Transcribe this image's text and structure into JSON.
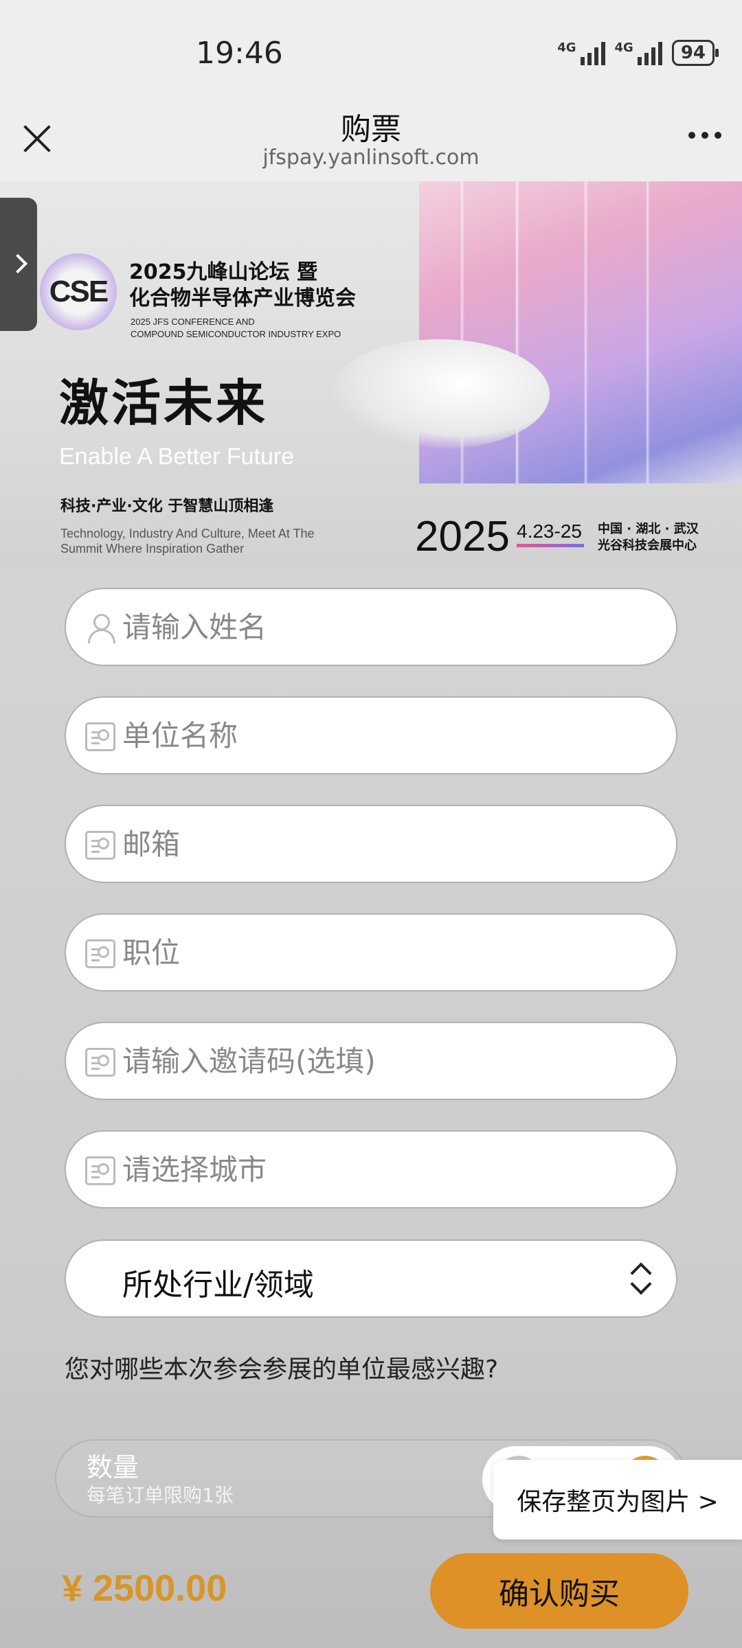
{
  "status_bar": {
    "time": "19:46",
    "network": [
      "4G",
      "4G"
    ],
    "battery": "94"
  },
  "nav": {
    "title": "购票",
    "url": "jfspay.yanlinsoft.com"
  },
  "banner": {
    "logo_text": "CSE",
    "conference_title_line1": "2025九峰山论坛 暨",
    "conference_title_line2": "化合物半导体产业博览会",
    "conference_en_line1": "2025 JFS CONFERENCE AND",
    "conference_en_line2": "COMPOUND SEMICONDUCTOR INDUSTRY EXPO",
    "slogan": "激活未来",
    "slogan_en": "Enable A Better Future",
    "tagline": "科技·产业·文化 于智慧山顶相逢",
    "tagline_en": "Technology, Industry And Culture, Meet At The Summit Where Inspiration Gather",
    "year": "2025",
    "dates": "4.23-25",
    "venue_line1": "中国 · 湖北 · 武汉",
    "venue_line2": "光谷科技会展中心"
  },
  "form": {
    "name_placeholder": "请输入姓名",
    "company_placeholder": "单位名称",
    "email_placeholder": "邮箱",
    "position_placeholder": "职位",
    "invite_placeholder": "请输入邀请码(选填)",
    "city_placeholder": "请选择城市",
    "industry_select": "所处行业/领域",
    "question": "您对哪些本次参会参展的单位最感兴趣?"
  },
  "quantity": {
    "label": "数量",
    "limit_note": "每笔订单限购1张"
  },
  "popup": {
    "save_page": "保存整页为图片 >"
  },
  "footer": {
    "price": "¥ 2500.00",
    "buy_label": "确认购买"
  },
  "colors": {
    "accent": "#dd9126",
    "price": "#d89528",
    "background": "#d0d0d0"
  }
}
